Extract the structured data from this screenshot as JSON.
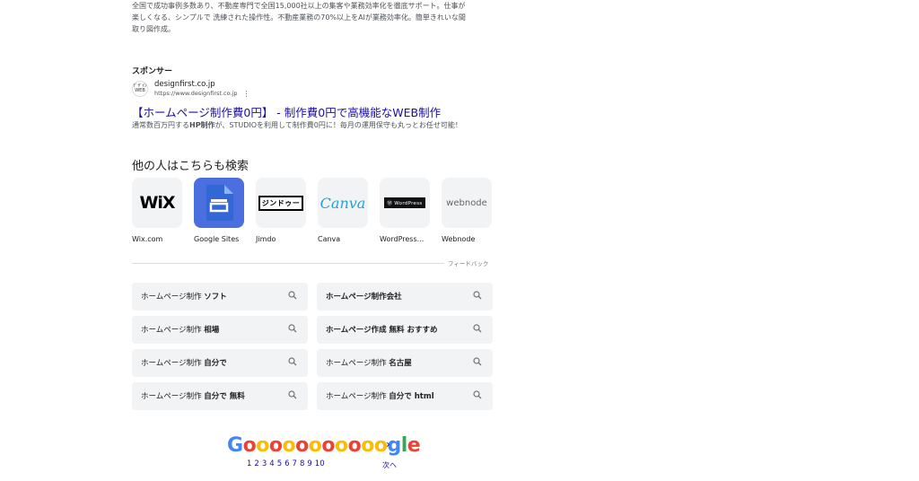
{
  "intro": {
    "lines": [
      "全国で成功事例多数あり、不動産専門で全国15,000社以上の集客や業務効率化を徹底サポート。仕事が",
      "楽しくなる、シンプルで 洗練された操作性。不動産業務の70%以上をAIが業務効率化。簡単きれいな間",
      "取り図作成。"
    ]
  },
  "ad": {
    "sponsor_label": "スポンサー",
    "logo_text": "ﾃﾞｻﾞｲﾝ WEB",
    "domain": "designfirst.co.jp",
    "url": "https://www.designfirst.co.jp",
    "kebab": "⋮",
    "title": "【ホームページ制作費0円】 - 制作費0円で高機能なWEB制作",
    "desc_pre": "通常数百万円する",
    "desc_bold": "HP制作",
    "desc_post": "が、STUDIOを利用して制作費0円に！毎月の運用保守も丸っとお任せ可能！"
  },
  "also_search": {
    "title": "他の人はこちらも検索",
    "items": [
      {
        "label": "Wix.com",
        "logo": "WiX"
      },
      {
        "label": "Google Sites",
        "logo": ""
      },
      {
        "label": "Jimdo",
        "logo": "ジンドゥー"
      },
      {
        "label": "Canva",
        "logo": "Canva"
      },
      {
        "label": "WordPress...",
        "logo": "Ⓦ WordPress"
      },
      {
        "label": "Webnode",
        "logo": "webnode"
      }
    ],
    "feedback": "フィードバック"
  },
  "related": [
    {
      "pre": "ホームページ制作 ",
      "bold": "ソフト"
    },
    {
      "pre": "",
      "bold": "ホームページ制作会社"
    },
    {
      "pre": "ホームページ制作 ",
      "bold": "相場"
    },
    {
      "pre": "",
      "bold": "ホームページ作成 無料 おすすめ"
    },
    {
      "pre": "ホームページ制作 ",
      "bold": "自分で"
    },
    {
      "pre": "ホームページ制作 ",
      "bold": "名古屋"
    },
    {
      "pre": "ホームページ制作 ",
      "bold": "自分で 無料"
    },
    {
      "pre": "ホームページ制作 ",
      "bold": "自分で html"
    }
  ],
  "pagination": {
    "logo": "Gooooooooooogle",
    "pages": [
      "1",
      "2",
      "3",
      "4",
      "5",
      "6",
      "7",
      "8",
      "9",
      "10"
    ],
    "current": "1",
    "next_label": "次へ",
    "next_icon": "chevron-right-icon"
  },
  "colors": {
    "link": "#1a0dab",
    "chip_bg": "#f1f3f4",
    "google_blue": "#4285f4",
    "google_red": "#ea4335",
    "google_yellow": "#fbbc05",
    "google_green": "#34a853"
  }
}
